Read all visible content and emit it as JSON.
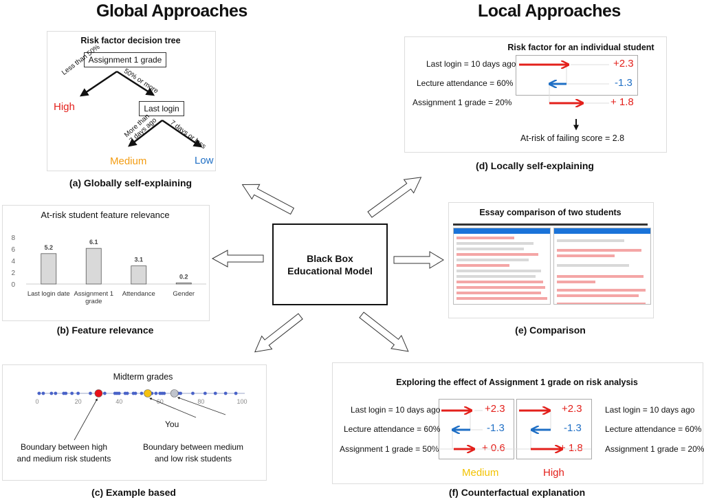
{
  "headers": {
    "global": "Global Approaches",
    "local": "Local Approaches"
  },
  "center": {
    "line1": "Black Box",
    "line2": "Educational Model"
  },
  "panel_a": {
    "title": "Risk factor decision tree",
    "root": "Assignment 1 grade",
    "left_edge": "Less than 50%",
    "right_edge": "50% or more",
    "left_leaf": "High",
    "node2": "Last login",
    "node2_left_edge_1": "More than",
    "node2_left_edge_2": "7 days ago",
    "node2_right_edge": "7 days or less",
    "leaf_medium": "Medium",
    "leaf_low": "Low",
    "caption": "(a) Globally self-explaining"
  },
  "panel_b": {
    "caption": "(b) Feature relevance",
    "chart_data": {
      "type": "bar",
      "title": "At-risk student feature relevance",
      "categories": [
        "Last login date",
        "Assignment 1 grade",
        "Attendance",
        "Gender"
      ],
      "values": [
        5.2,
        6.1,
        3.1,
        0.2
      ],
      "value_labels": [
        "5.2",
        "6.1",
        "3.1",
        "0.2"
      ],
      "yticks": [
        "0",
        "2",
        "4",
        "6",
        "8"
      ],
      "ylim": [
        0,
        8
      ],
      "xlabel": "",
      "ylabel": "",
      "bar_color": "#d9d9d9"
    }
  },
  "panel_c": {
    "title": "Midterm grades",
    "xticks": [
      "0",
      "20",
      "40",
      "60",
      "80",
      "100"
    ],
    "xlim": [
      0,
      100
    ],
    "points": [
      1,
      3,
      7,
      9,
      13,
      14,
      17,
      20,
      26,
      33,
      38,
      39,
      40,
      43,
      44,
      47,
      48,
      51,
      56,
      58,
      60,
      61,
      62,
      69,
      70,
      76,
      82,
      87,
      92,
      97
    ],
    "markers": [
      {
        "name": "high-medium-boundary",
        "value": 30,
        "color": "#e8101a"
      },
      {
        "name": "you",
        "value": 54,
        "color": "#f5c211"
      },
      {
        "name": "medium-low-boundary",
        "value": 67,
        "color": "#c0c4cc"
      }
    ],
    "you_label": "You",
    "boundary_high_1": "Boundary between high",
    "boundary_high_2": "and medium risk students",
    "boundary_low_1": "Boundary between medium",
    "boundary_low_2": "and low risk students",
    "caption": "(c) Example based"
  },
  "panel_d": {
    "title": "Risk factor for an individual student",
    "rows": [
      {
        "label": "Last login = 10 days ago",
        "value": "+2.3",
        "color": "red"
      },
      {
        "label": "Lecture attendance = 60%",
        "value": "-1.3",
        "color": "blue"
      },
      {
        "label": "Assignment 1 grade = 20%",
        "value": "+ 1.8",
        "color": "red"
      }
    ],
    "score": "At-risk of failing score = 2.8",
    "caption": "(d) Locally self-explaining"
  },
  "panel_e": {
    "title": "Essay comparison of two students",
    "caption": "(e) Comparison"
  },
  "panel_f": {
    "title": "Exploring the effect of Assignment 1 grade on risk analysis",
    "left_rows": [
      {
        "label": "Last login = 10 days ago",
        "value": "+2.3",
        "color": "red"
      },
      {
        "label": "Lecture attendance = 60%",
        "value": "-1.3",
        "color": "blue"
      },
      {
        "label": "Assignment 1 grade = 50%",
        "value": "+ 0.6",
        "color": "red"
      }
    ],
    "right_rows": [
      {
        "label": "Last login = 10 days ago",
        "value": "+2.3",
        "color": "red"
      },
      {
        "label": "Lecture attendance = 60%",
        "value": "-1.3",
        "color": "blue"
      },
      {
        "label": "Assignment 1 grade = 20%",
        "value": "+ 1.8",
        "color": "red"
      }
    ],
    "left_outcome": "Medium",
    "right_outcome": "High",
    "caption": "(f) Counterfactual  explanation"
  },
  "colors": {
    "red": "#e3201b",
    "blue": "#1f6fc5",
    "orange": "#f39c12",
    "yellow": "#f2c200"
  }
}
